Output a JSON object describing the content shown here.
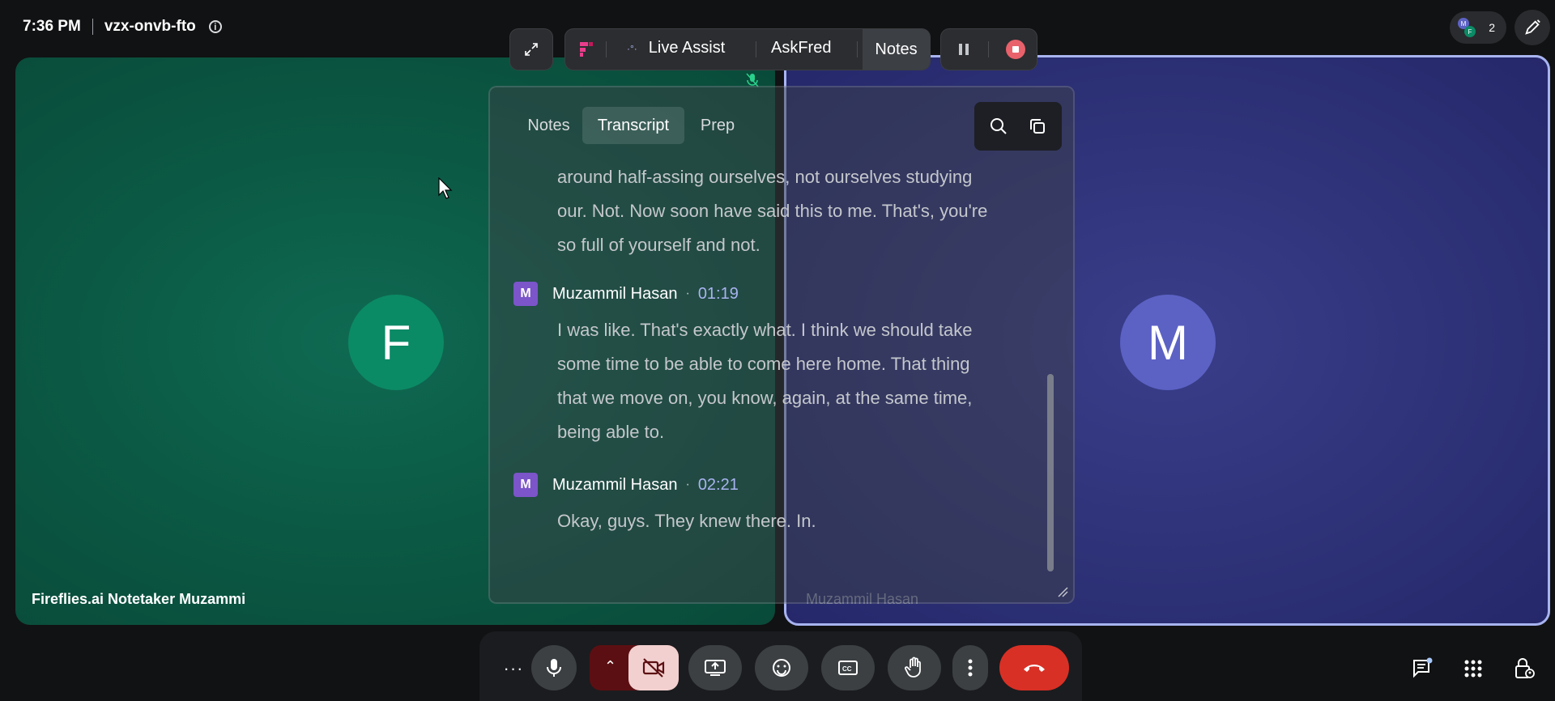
{
  "meeting": {
    "time": "7:36 PM",
    "code": "vzx-onvb-fto",
    "info_icon": "info-icon"
  },
  "top_right": {
    "participant_count": "2",
    "mini_avatar_1": "M",
    "mini_avatar_2": "F"
  },
  "tiles": {
    "left": {
      "initial": "F",
      "name": "Fireflies.ai Notetaker Muzammi",
      "color": "#0b8a66"
    },
    "right": {
      "initial": "M",
      "name": "Muzammil Hasan",
      "color": "#5c62c4"
    }
  },
  "fireflies_toolbar": {
    "live_assist": "Live Assist",
    "askfred": "AskFred",
    "notes": "Notes"
  },
  "panel": {
    "tabs": [
      {
        "label": "Notes"
      },
      {
        "label": "Transcript"
      },
      {
        "label": "Prep"
      }
    ],
    "active_tab": "Transcript",
    "transcript": [
      {
        "text_lines": [
          "around half-assing ourselves, not ourselves studying",
          "our. Not. Now soon have said this to me. That's, you're",
          "so full of yourself and not."
        ]
      },
      {
        "initial": "M",
        "speaker": "Muzammil Hasan",
        "time": "01:19",
        "text_lines": [
          "I was like. That's exactly what. I think we should take",
          "some time to be able to come here home. That thing",
          "that we move on, you know, again, at the same time,",
          "being able to."
        ]
      },
      {
        "initial": "M",
        "speaker": "Muzammil Hasan",
        "time": "02:21",
        "text_lines": [
          "Okay, guys. They knew there. In."
        ]
      }
    ]
  },
  "colors": {
    "end_call": "#d93025",
    "camera_off_bg": "#f2d0d0",
    "accent": "#a8b4f0"
  }
}
